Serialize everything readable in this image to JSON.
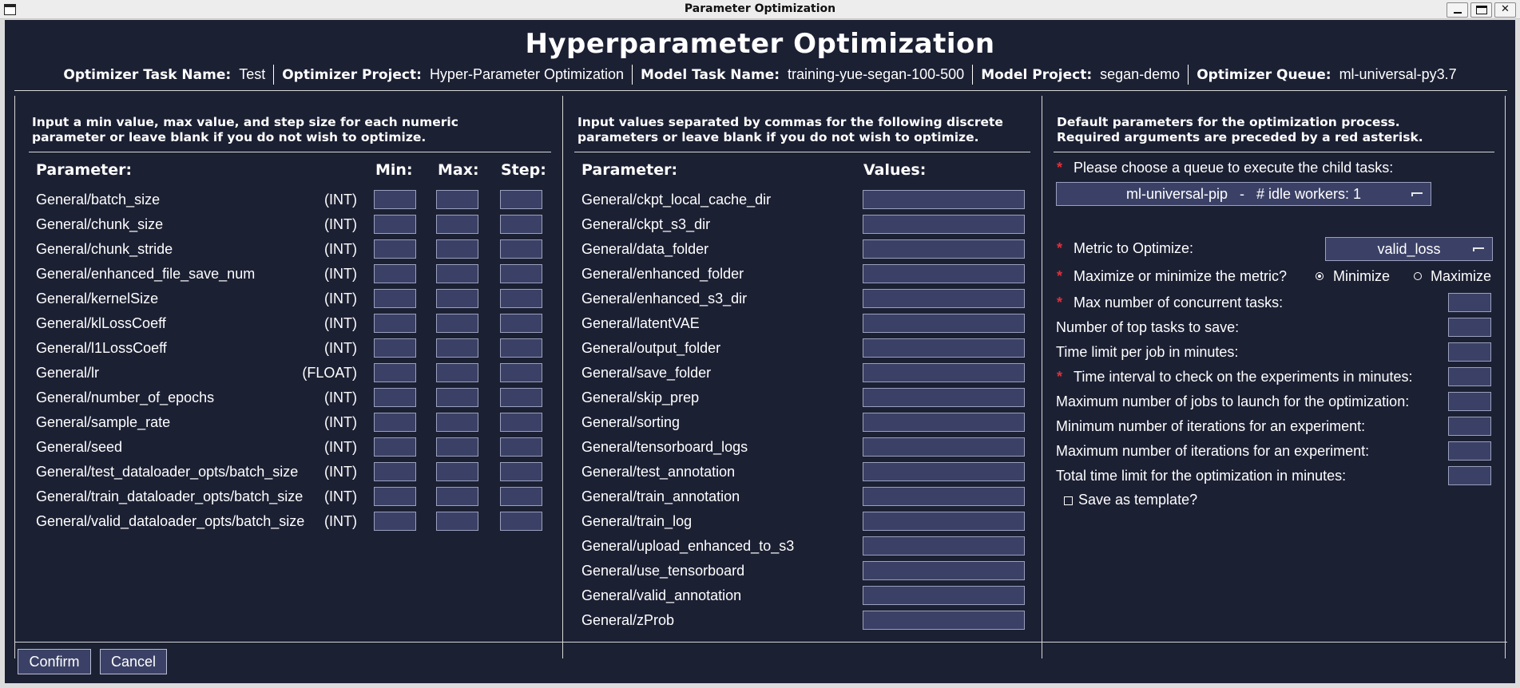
{
  "window": {
    "title": "Parameter Optimization"
  },
  "header": {
    "heading": "Hyperparameter Optimization",
    "info": [
      {
        "key": "Optimizer Task Name:",
        "value": "Test"
      },
      {
        "key": "Optimizer Project:",
        "value": "Hyper-Parameter Optimization"
      },
      {
        "key": "Model Task Name:",
        "value": "training-yue-segan-100-500"
      },
      {
        "key": "Model Project:",
        "value": "segan-demo"
      },
      {
        "key": "Optimizer Queue:",
        "value": "ml-universal-py3.7"
      }
    ]
  },
  "numeric": {
    "instructions_line1": "Input a min value, max value, and step size for each numeric",
    "instructions_line2": "parameter or leave blank if you do not wish to optimize.",
    "col_parameter": "Parameter:",
    "col_min": "Min:",
    "col_max": "Max:",
    "col_step": "Step:",
    "params": [
      {
        "name": "General/batch_size",
        "type": "(INT)"
      },
      {
        "name": "General/chunk_size",
        "type": "(INT)"
      },
      {
        "name": "General/chunk_stride",
        "type": "(INT)"
      },
      {
        "name": "General/enhanced_file_save_num",
        "type": "(INT)"
      },
      {
        "name": "General/kernelSize",
        "type": "(INT)"
      },
      {
        "name": "General/klLossCoeff",
        "type": "(INT)"
      },
      {
        "name": "General/l1LossCoeff",
        "type": "(INT)"
      },
      {
        "name": "General/lr",
        "type": "(FLOAT)"
      },
      {
        "name": "General/number_of_epochs",
        "type": "(INT)"
      },
      {
        "name": "General/sample_rate",
        "type": "(INT)"
      },
      {
        "name": "General/seed",
        "type": "(INT)"
      },
      {
        "name": "General/test_dataloader_opts/batch_size",
        "type": "(INT)"
      },
      {
        "name": "General/train_dataloader_opts/batch_size",
        "type": "(INT)"
      },
      {
        "name": "General/valid_dataloader_opts/batch_size",
        "type": "(INT)"
      }
    ]
  },
  "discrete": {
    "instructions_line1": "Input values separated by commas for the following discrete",
    "instructions_line2": "parameters or leave blank if you do not wish to optimize.",
    "col_parameter": "Parameter:",
    "col_values": "Values:",
    "params": [
      "General/ckpt_local_cache_dir",
      "General/ckpt_s3_dir",
      "General/data_folder",
      "General/enhanced_folder",
      "General/enhanced_s3_dir",
      "General/latentVAE",
      "General/output_folder",
      "General/save_folder",
      "General/skip_prep",
      "General/sorting",
      "General/tensorboard_logs",
      "General/test_annotation",
      "General/train_annotation",
      "General/train_log",
      "General/upload_enhanced_to_s3",
      "General/use_tensorboard",
      "General/valid_annotation",
      "General/zProb"
    ]
  },
  "defaults": {
    "instructions_line1": "Default parameters for the optimization process.",
    "instructions_line2": "Required arguments are preceded by a red asterisk.",
    "required_mark": "*",
    "queue_label": "Please choose a queue to execute the child tasks:",
    "queue_selected": "ml-universal-pip   -   # idle workers: 1",
    "metric_label": "Metric to Optimize:",
    "metric_selected": "valid_loss",
    "direction_label": "Maximize or minimize the metric?",
    "direction_minimize": "Minimize",
    "direction_maximize": "Maximize",
    "direction_selected": "Minimize",
    "fields": [
      {
        "label": "Max number of concurrent tasks:",
        "required": true
      },
      {
        "label": "Number of top tasks to save:",
        "required": false
      },
      {
        "label": "Time limit per job in minutes:",
        "required": false
      },
      {
        "label": "Time interval to check on the experiments in minutes:",
        "required": true
      },
      {
        "label": "Maximum number of jobs to launch for the optimization:",
        "required": false
      },
      {
        "label": "Minimum number of iterations for an experiment:",
        "required": false
      },
      {
        "label": "Maximum number of iterations for an experiment:",
        "required": false
      },
      {
        "label": "Total time limit for the optimization in minutes:",
        "required": false
      }
    ],
    "save_template_label": "Save as template?",
    "save_template_checked": false
  },
  "footer": {
    "confirm_label": "Confirm",
    "cancel_label": "Cancel"
  },
  "colors": {
    "background": "#1c2033",
    "input": "#3b4166",
    "required": "#e0303a"
  }
}
